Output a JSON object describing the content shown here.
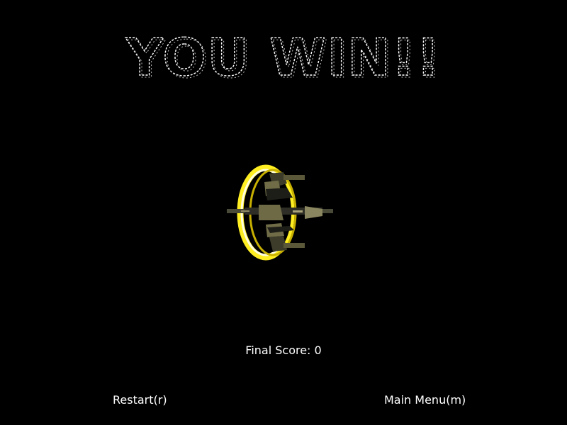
{
  "game": {
    "title": "YOU WIN!!",
    "final_score_label": "Final Score:",
    "final_score_value": "0",
    "final_score_text": "Final Score: 0",
    "restart_label": "Restart(r)",
    "main_menu_label": "Main Menu(m)"
  },
  "colors": {
    "background": "#000000",
    "text": "#ffffff",
    "ring_glow": "#ffee00",
    "ship_body": "#7a7648"
  },
  "icons": {
    "title": "wireframe-title-text",
    "ship": "spaceship-with-yellow-ring"
  }
}
